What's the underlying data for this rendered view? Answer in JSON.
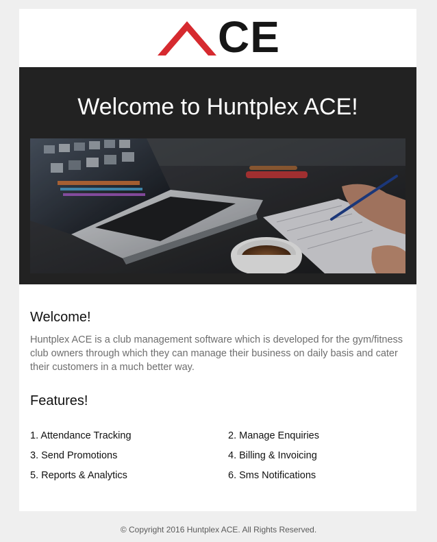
{
  "brand": {
    "logo_text": "CE",
    "logo_accent_color": "#d62a2f"
  },
  "hero": {
    "title": "Welcome to Huntplex ACE!",
    "image_alt": "laptop with coffee and notebook"
  },
  "welcome": {
    "heading": "Welcome!",
    "body": "Huntplex ACE is a club management software which is developed for the gym/fitness club owners through which they can manage their business on daily basis and cater their customers in a much better way."
  },
  "features": {
    "heading": "Features!",
    "items": [
      "1. Attendance Tracking",
      "2. Manage Enquiries",
      "3. Send Promotions",
      "4. Billing & Invoicing",
      "5. Reports & Analytics",
      "6. Sms Notifications"
    ]
  },
  "footer": {
    "copyright": "© Copyright 2016 Huntplex ACE. All Rights Reserved."
  }
}
